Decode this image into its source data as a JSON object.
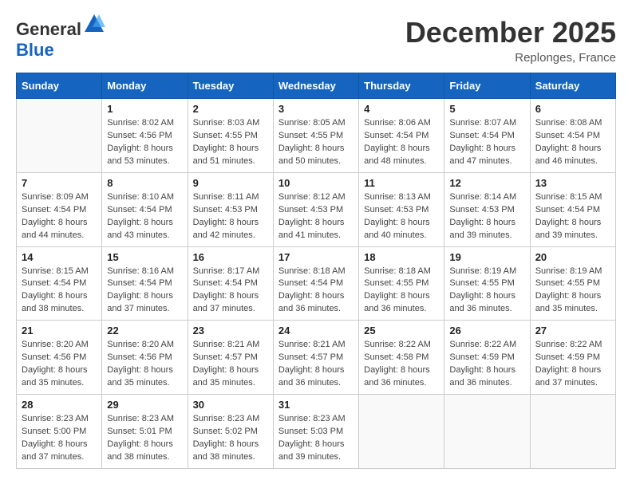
{
  "header": {
    "logo_general": "General",
    "logo_blue": "Blue",
    "month": "December 2025",
    "location": "Replonges, France"
  },
  "days_of_week": [
    "Sunday",
    "Monday",
    "Tuesday",
    "Wednesday",
    "Thursday",
    "Friday",
    "Saturday"
  ],
  "weeks": [
    [
      {
        "day": "",
        "info": ""
      },
      {
        "day": "1",
        "info": "Sunrise: 8:02 AM\nSunset: 4:56 PM\nDaylight: 8 hours\nand 53 minutes."
      },
      {
        "day": "2",
        "info": "Sunrise: 8:03 AM\nSunset: 4:55 PM\nDaylight: 8 hours\nand 51 minutes."
      },
      {
        "day": "3",
        "info": "Sunrise: 8:05 AM\nSunset: 4:55 PM\nDaylight: 8 hours\nand 50 minutes."
      },
      {
        "day": "4",
        "info": "Sunrise: 8:06 AM\nSunset: 4:54 PM\nDaylight: 8 hours\nand 48 minutes."
      },
      {
        "day": "5",
        "info": "Sunrise: 8:07 AM\nSunset: 4:54 PM\nDaylight: 8 hours\nand 47 minutes."
      },
      {
        "day": "6",
        "info": "Sunrise: 8:08 AM\nSunset: 4:54 PM\nDaylight: 8 hours\nand 46 minutes."
      }
    ],
    [
      {
        "day": "7",
        "info": "Sunrise: 8:09 AM\nSunset: 4:54 PM\nDaylight: 8 hours\nand 44 minutes."
      },
      {
        "day": "8",
        "info": "Sunrise: 8:10 AM\nSunset: 4:54 PM\nDaylight: 8 hours\nand 43 minutes."
      },
      {
        "day": "9",
        "info": "Sunrise: 8:11 AM\nSunset: 4:53 PM\nDaylight: 8 hours\nand 42 minutes."
      },
      {
        "day": "10",
        "info": "Sunrise: 8:12 AM\nSunset: 4:53 PM\nDaylight: 8 hours\nand 41 minutes."
      },
      {
        "day": "11",
        "info": "Sunrise: 8:13 AM\nSunset: 4:53 PM\nDaylight: 8 hours\nand 40 minutes."
      },
      {
        "day": "12",
        "info": "Sunrise: 8:14 AM\nSunset: 4:53 PM\nDaylight: 8 hours\nand 39 minutes."
      },
      {
        "day": "13",
        "info": "Sunrise: 8:15 AM\nSunset: 4:54 PM\nDaylight: 8 hours\nand 39 minutes."
      }
    ],
    [
      {
        "day": "14",
        "info": "Sunrise: 8:15 AM\nSunset: 4:54 PM\nDaylight: 8 hours\nand 38 minutes."
      },
      {
        "day": "15",
        "info": "Sunrise: 8:16 AM\nSunset: 4:54 PM\nDaylight: 8 hours\nand 37 minutes."
      },
      {
        "day": "16",
        "info": "Sunrise: 8:17 AM\nSunset: 4:54 PM\nDaylight: 8 hours\nand 37 minutes."
      },
      {
        "day": "17",
        "info": "Sunrise: 8:18 AM\nSunset: 4:54 PM\nDaylight: 8 hours\nand 36 minutes."
      },
      {
        "day": "18",
        "info": "Sunrise: 8:18 AM\nSunset: 4:55 PM\nDaylight: 8 hours\nand 36 minutes."
      },
      {
        "day": "19",
        "info": "Sunrise: 8:19 AM\nSunset: 4:55 PM\nDaylight: 8 hours\nand 36 minutes."
      },
      {
        "day": "20",
        "info": "Sunrise: 8:19 AM\nSunset: 4:55 PM\nDaylight: 8 hours\nand 35 minutes."
      }
    ],
    [
      {
        "day": "21",
        "info": "Sunrise: 8:20 AM\nSunset: 4:56 PM\nDaylight: 8 hours\nand 35 minutes."
      },
      {
        "day": "22",
        "info": "Sunrise: 8:20 AM\nSunset: 4:56 PM\nDaylight: 8 hours\nand 35 minutes."
      },
      {
        "day": "23",
        "info": "Sunrise: 8:21 AM\nSunset: 4:57 PM\nDaylight: 8 hours\nand 35 minutes."
      },
      {
        "day": "24",
        "info": "Sunrise: 8:21 AM\nSunset: 4:57 PM\nDaylight: 8 hours\nand 36 minutes."
      },
      {
        "day": "25",
        "info": "Sunrise: 8:22 AM\nSunset: 4:58 PM\nDaylight: 8 hours\nand 36 minutes."
      },
      {
        "day": "26",
        "info": "Sunrise: 8:22 AM\nSunset: 4:59 PM\nDaylight: 8 hours\nand 36 minutes."
      },
      {
        "day": "27",
        "info": "Sunrise: 8:22 AM\nSunset: 4:59 PM\nDaylight: 8 hours\nand 37 minutes."
      }
    ],
    [
      {
        "day": "28",
        "info": "Sunrise: 8:23 AM\nSunset: 5:00 PM\nDaylight: 8 hours\nand 37 minutes."
      },
      {
        "day": "29",
        "info": "Sunrise: 8:23 AM\nSunset: 5:01 PM\nDaylight: 8 hours\nand 38 minutes."
      },
      {
        "day": "30",
        "info": "Sunrise: 8:23 AM\nSunset: 5:02 PM\nDaylight: 8 hours\nand 38 minutes."
      },
      {
        "day": "31",
        "info": "Sunrise: 8:23 AM\nSunset: 5:03 PM\nDaylight: 8 hours\nand 39 minutes."
      },
      {
        "day": "",
        "info": ""
      },
      {
        "day": "",
        "info": ""
      },
      {
        "day": "",
        "info": ""
      }
    ]
  ]
}
